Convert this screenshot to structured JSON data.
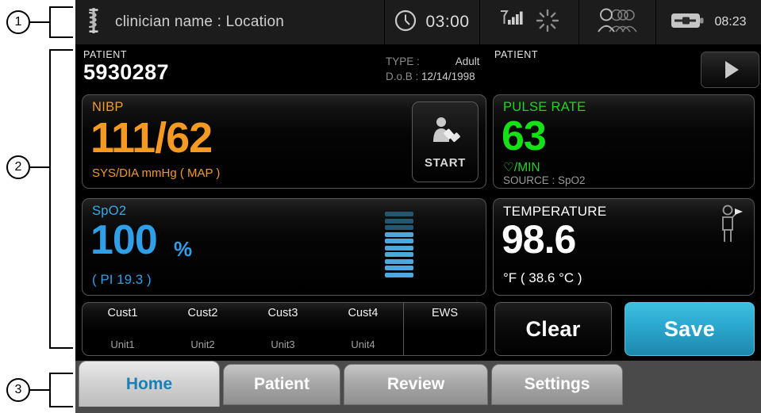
{
  "callouts": [
    {
      "num": "1"
    },
    {
      "num": "2"
    },
    {
      "num": "3"
    }
  ],
  "topbar": {
    "logo_icon": "caduceus-icon",
    "clinician": "clinician name : Location",
    "timer_icon": "clock-icon",
    "timer": "03:00",
    "signal_icon": "wifi-signal-icon",
    "activity_icon": "spinner-icon",
    "people_icon": "patient-group-icon",
    "battery_icon": "battery-charging-icon",
    "time": "08:23"
  },
  "header": {
    "patient_label": "PATIENT",
    "patient_id": "5930287",
    "type_key": "TYPE :",
    "type_value": "Adult",
    "dob_key": "D.o.B :",
    "dob_value": "12/14/1998",
    "right_patient_label": "PATIENT",
    "play_icon": "play-icon"
  },
  "vitals": {
    "nibp": {
      "title": "NIBP",
      "value": "111/62",
      "units": "SYS/DIA mmHg ( MAP )",
      "color": "#f59a20",
      "start_label": "START",
      "start_icon": "bp-cuff-person-icon"
    },
    "pulse": {
      "title": "PULSE RATE",
      "value": "63",
      "units": "♡/MIN",
      "source": "SOURCE : SpO2",
      "color": "#16e016"
    },
    "spo2": {
      "title": "SpO2",
      "value": "100",
      "percent": "%",
      "pi": "( PI 19.3 )",
      "color": "#2f9fe8",
      "pleth_icon": "pleth-bargraph-icon",
      "pleth_total_segments": 10,
      "pleth_lit_segments": 7
    },
    "temperature": {
      "title": "TEMPERATURE",
      "value": "98.6",
      "units": "°F  ( 38.6 °C )",
      "color": "#ffffff",
      "probe_icon": "temporal-thermometer-person-icon"
    }
  },
  "custom_row": {
    "cells": [
      {
        "name": "Cust1",
        "unit": "Unit1"
      },
      {
        "name": "Cust2",
        "unit": "Unit2"
      },
      {
        "name": "Cust3",
        "unit": "Unit3"
      },
      {
        "name": "Cust4",
        "unit": "Unit4"
      }
    ],
    "ews_label": "EWS"
  },
  "actions": {
    "clear_label": "Clear",
    "save_label": "Save",
    "save_color": "#2ba7cd"
  },
  "tabs": [
    {
      "label": "Home",
      "active": true
    },
    {
      "label": "Patient",
      "active": false
    },
    {
      "label": "Review",
      "active": false
    },
    {
      "label": "Settings",
      "active": false
    }
  ]
}
